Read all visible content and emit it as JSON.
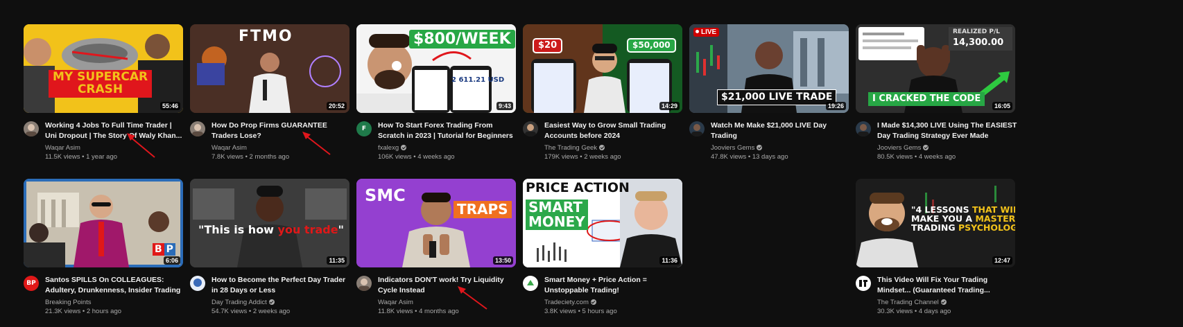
{
  "videos": [
    {
      "thumb_text": [
        "MY SUPERCAR",
        "CRASH"
      ],
      "duration": "55:46",
      "title": "Working 4 Jobs To Full Time Trader | Uni Dropout | The Story Of Waly Khan...",
      "channel": "Waqar Asim",
      "verified": false,
      "views": "11.5K views",
      "age": "1 year ago",
      "avatar_glyph": "",
      "thumb_bg": "#f2c21a"
    },
    {
      "thumb_text": [
        "FTMO"
      ],
      "duration": "20:52",
      "title": "How Do Prop Firms GUARANTEE Traders Lose?",
      "channel": "Waqar Asim",
      "verified": false,
      "views": "7.8K views",
      "age": "2 months ago",
      "avatar_glyph": "",
      "thumb_bg": "#3a2420"
    },
    {
      "thumb_text": [
        "$800/WEEK",
        "2 611.21 USD"
      ],
      "duration": "9:43",
      "title": "How To Start Forex Trading From Scratch in 2023 | Tutorial for Beginners",
      "channel": "fxalexg",
      "verified": true,
      "views": "106K views",
      "age": "4 weeks ago",
      "avatar_glyph": "F",
      "thumb_bg": "#f4f4f4"
    },
    {
      "thumb_text": [
        "$20",
        "$50,000"
      ],
      "duration": "14:29",
      "title": "Easiest Way to Grow Small Trading Accounts before 2024",
      "channel": "The Trading Geek",
      "verified": true,
      "views": "179K views",
      "age": "2 weeks ago",
      "avatar_glyph": "",
      "thumb_bg": "#1e7a2e"
    },
    {
      "thumb_text": [
        "LIVE",
        "$21,000 LIVE TRADE"
      ],
      "duration": "19:26",
      "title": "Watch Me Make $21,000 LIVE Day Trading",
      "channel": "Jooviers Gems",
      "verified": true,
      "views": "47.8K views",
      "age": "13 days ago",
      "avatar_glyph": "",
      "thumb_bg": "#5a6a78"
    },
    {
      "thumb_text": [
        "REALIZED P/L",
        "14,300.00",
        "I CRACKED THE CODE"
      ],
      "duration": "16:05",
      "title": "I Made $14,300 LIVE Using The EASIEST Day Trading Strategy Ever Made",
      "channel": "Jooviers Gems",
      "verified": true,
      "views": "80.5K views",
      "age": "4 weeks ago",
      "avatar_glyph": "",
      "thumb_bg": "#2a2a2a"
    },
    {
      "thumb_text": [
        "B",
        "P"
      ],
      "duration": "6:06",
      "title": "Santos SPILLS On COLLEAGUES: Adultery, Drunkenness, Insider Trading |...",
      "channel": "Breaking Points",
      "verified": false,
      "views": "21.3K views",
      "age": "2 hours ago",
      "avatar_glyph": "BP",
      "thumb_bg": "#2b6cb8"
    },
    {
      "thumb_text": [
        "\"This is how ",
        "you trade",
        "\""
      ],
      "duration": "11:35",
      "title": "How to Become the Perfect Day Trader in 28 Days or Less",
      "channel": "Day Trading Addict",
      "verified": true,
      "views": "54.7K views",
      "age": "2 weeks ago",
      "avatar_glyph": "",
      "thumb_bg": "#3c3c3c"
    },
    {
      "thumb_text": [
        "SMC",
        "TRAPS"
      ],
      "duration": "13:50",
      "title": "Indicators DON'T work! Try Liquidity Cycle Instead",
      "channel": "Waqar Asim",
      "verified": false,
      "views": "11.8K views",
      "age": "4 months ago",
      "avatar_glyph": "",
      "thumb_bg": "#8a3cc8"
    },
    {
      "thumb_text": [
        "PRICE ACTION",
        "SMART",
        "MONEY"
      ],
      "duration": "11:36",
      "title": "Smart Money + Price Action = Unstoppable Trading!",
      "channel": "Tradeciety.com",
      "verified": true,
      "views": "3.8K views",
      "age": "5 hours ago",
      "avatar_glyph": "",
      "thumb_bg": "#ffffff"
    },
    {
      "thumb_text": [
        "\"4 LESSONS ",
        "THAT WILL",
        "MAKE YOU A ",
        "MASTER",
        " OF",
        "TRADING ",
        "PSYCHOLOGY",
        "\""
      ],
      "duration": "12:47",
      "title": "This Video Will Fix Your Trading Mindset... (Guaranteed Trading...",
      "channel": "The Trading Channel",
      "verified": true,
      "views": "30.3K views",
      "age": "4 days ago",
      "avatar_glyph": "",
      "thumb_bg": "#1a1a1a"
    }
  ],
  "colors": {
    "background": "#0f0f0f",
    "title": "#f1f1f1",
    "secondary": "#aaaaaa",
    "annotation_arrow": "#e0161c",
    "live_red": "#cc0000"
  }
}
